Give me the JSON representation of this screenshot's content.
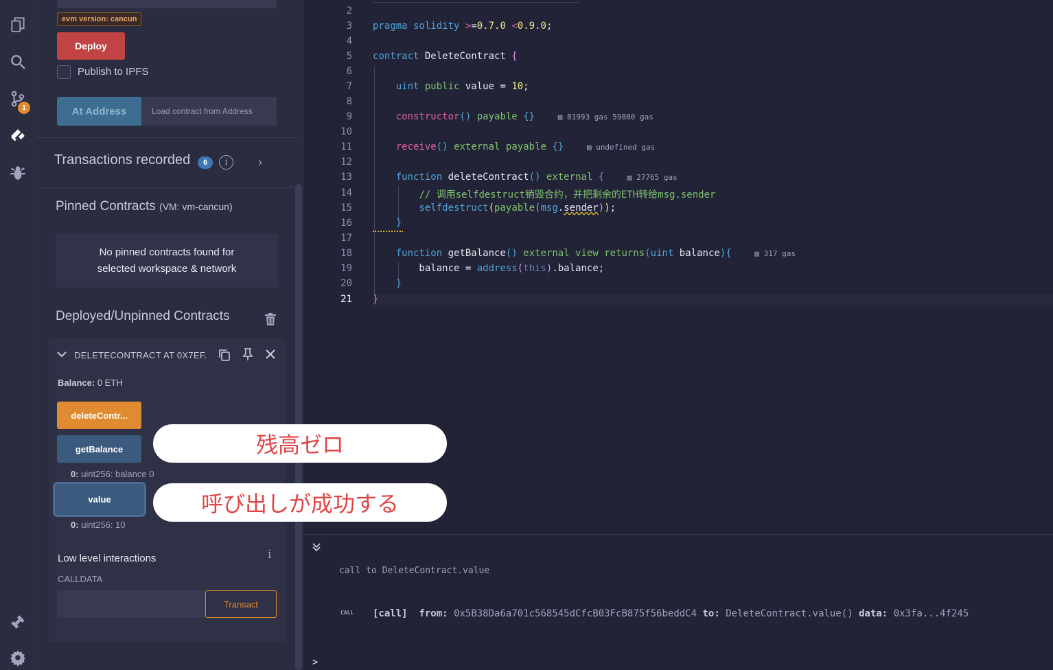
{
  "deploy_panel": {
    "evm_badge": "evm version: cancun",
    "deploy_label": "Deploy",
    "publish_label": "Publish to IPFS",
    "at_address_label": "At Address",
    "load_placeholder": "Load contract from Address"
  },
  "transactions": {
    "title": "Transactions recorded",
    "count": "6",
    "info_glyph": "i",
    "chevron": "›"
  },
  "pinned": {
    "title": "Pinned Contracts",
    "env": "(VM: vm-cancun)",
    "empty_line1": "No pinned contracts found for",
    "empty_line2": "selected workspace & network"
  },
  "deployed": {
    "title": "Deployed/Unpinned Contracts",
    "contract_name": "DELETECONTRACT AT 0X7EF.",
    "balance_label": "Balance:",
    "balance_value": "0 ETH",
    "functions": [
      {
        "label": "deleteContr...",
        "color": "orange"
      },
      {
        "label": "getBalance",
        "color": "blue",
        "result_key": "0:",
        "result_value": "uint256: balance 0"
      },
      {
        "label": "value",
        "color": "blue",
        "result_key": "0:",
        "result_value": "uint256: 10"
      }
    ],
    "low_level_title": "Low level interactions",
    "low_level_info": "i",
    "calldata_label": "CALLDATA",
    "transact_label": "Transact"
  },
  "editor": {
    "line_numbers": [
      "2",
      "3",
      "4",
      "5",
      "6",
      "7",
      "8",
      "9",
      "10",
      "11",
      "12",
      "13",
      "14",
      "15",
      "16",
      "17",
      "18",
      "19",
      "20",
      "21"
    ],
    "active_line": "21",
    "gas": {
      "constructor": "81993 gas 59800 gas",
      "receive": "undefined gas",
      "deleteContract": "27765 gas",
      "getBalance": "317 gas"
    },
    "comment_line": "// 调用selfdestruct销毁合约，并把剩余的ETH转给msg.sender"
  },
  "terminal": {
    "line1": "call to DeleteContract.value",
    "tag": "CALL",
    "call_label": "[call]",
    "from_label": "from:",
    "from_value": "0x5B38Da6a701c568545dCfcB03FcB875f56beddC4",
    "to_label": "to:",
    "to_value": "DeleteContract.value()",
    "data_label": "data:",
    "data_value": "0x3fa...4f245",
    "prompt": ">"
  },
  "annotations": {
    "balance_zero": "残高ゼロ",
    "call_success": "呼び出しが成功する"
  },
  "icons": [
    "files-icon",
    "search-icon",
    "git-icon",
    "deploy-run-icon",
    "debugger-icon",
    "plugin-manager-icon",
    "settings-icon",
    "trash-icon",
    "copy-icon",
    "pin-icon",
    "close-icon",
    "chevron-down-icon",
    "chevron-right-icon",
    "gas-pump-icon",
    "terminal-toggle-icon"
  ],
  "colors": {
    "deploy": "#c24343",
    "at_address": "#3d6e91",
    "orange_fn": "#e08a31",
    "blue_fn": "#3b5a7d",
    "annotation_text": "#e04545",
    "notification_badge": "#e08a31",
    "count_badge": "#3d77b4"
  },
  "iconbar": {
    "git_badge": "1"
  }
}
